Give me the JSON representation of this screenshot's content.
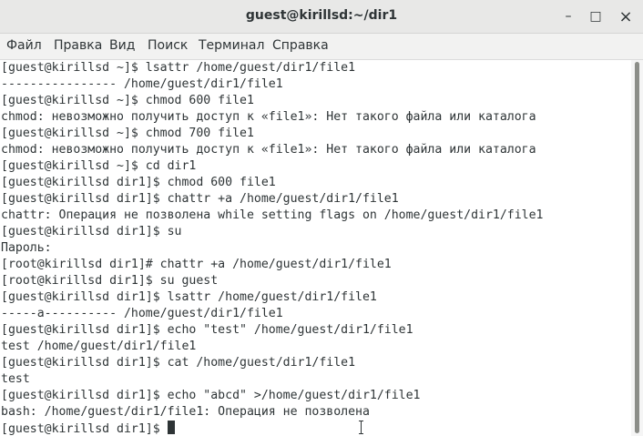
{
  "window": {
    "title": "guest@kirillsd:~/dir1",
    "minimize_glyph": "–",
    "maximize_glyph": "□",
    "close_glyph": "×"
  },
  "menu": [
    "Файл",
    "Правка",
    "Вид",
    "Поиск",
    "Терминал",
    "Справка"
  ],
  "terminal": {
    "lines": [
      "[guest@kirillsd ~]$ lsattr /home/guest/dir1/file1",
      "---------------- /home/guest/dir1/file1",
      "[guest@kirillsd ~]$ chmod 600 file1",
      "chmod: невозможно получить доступ к «file1»: Нет такого файла или каталога",
      "[guest@kirillsd ~]$ chmod 700 file1",
      "chmod: невозможно получить доступ к «file1»: Нет такого файла или каталога",
      "[guest@kirillsd ~]$ cd dir1",
      "[guest@kirillsd dir1]$ chmod 600 file1",
      "[guest@kirillsd dir1]$ chattr +a /home/guest/dir1/file1",
      "chattr: Операция не позволена while setting flags on /home/guest/dir1/file1",
      "[guest@kirillsd dir1]$ su",
      "Пароль:",
      "[root@kirillsd dir1]# chattr +a /home/guest/dir1/file1",
      "[root@kirillsd dir1]$ su guest",
      "[guest@kirillsd dir1]$ lsattr /home/guest/dir1/file1",
      "-----a---------- /home/guest/dir1/file1",
      "[guest@kirillsd dir1]$ echo \"test\" /home/guest/dir1/file1",
      "test /home/guest/dir1/file1",
      "[guest@kirillsd dir1]$ cat /home/guest/dir1/file1",
      "test",
      "[guest@kirillsd dir1]$ echo \"abcd\" >/home/guest/dir1/file1",
      "bash: /home/guest/dir1/file1: Операция не позволена"
    ],
    "prompt": "[guest@kirillsd dir1]$ "
  },
  "icons": {
    "minimize": "minimize-icon",
    "maximize": "maximize-icon",
    "close": "close-icon",
    "text_cursor": "text-cursor-icon"
  }
}
